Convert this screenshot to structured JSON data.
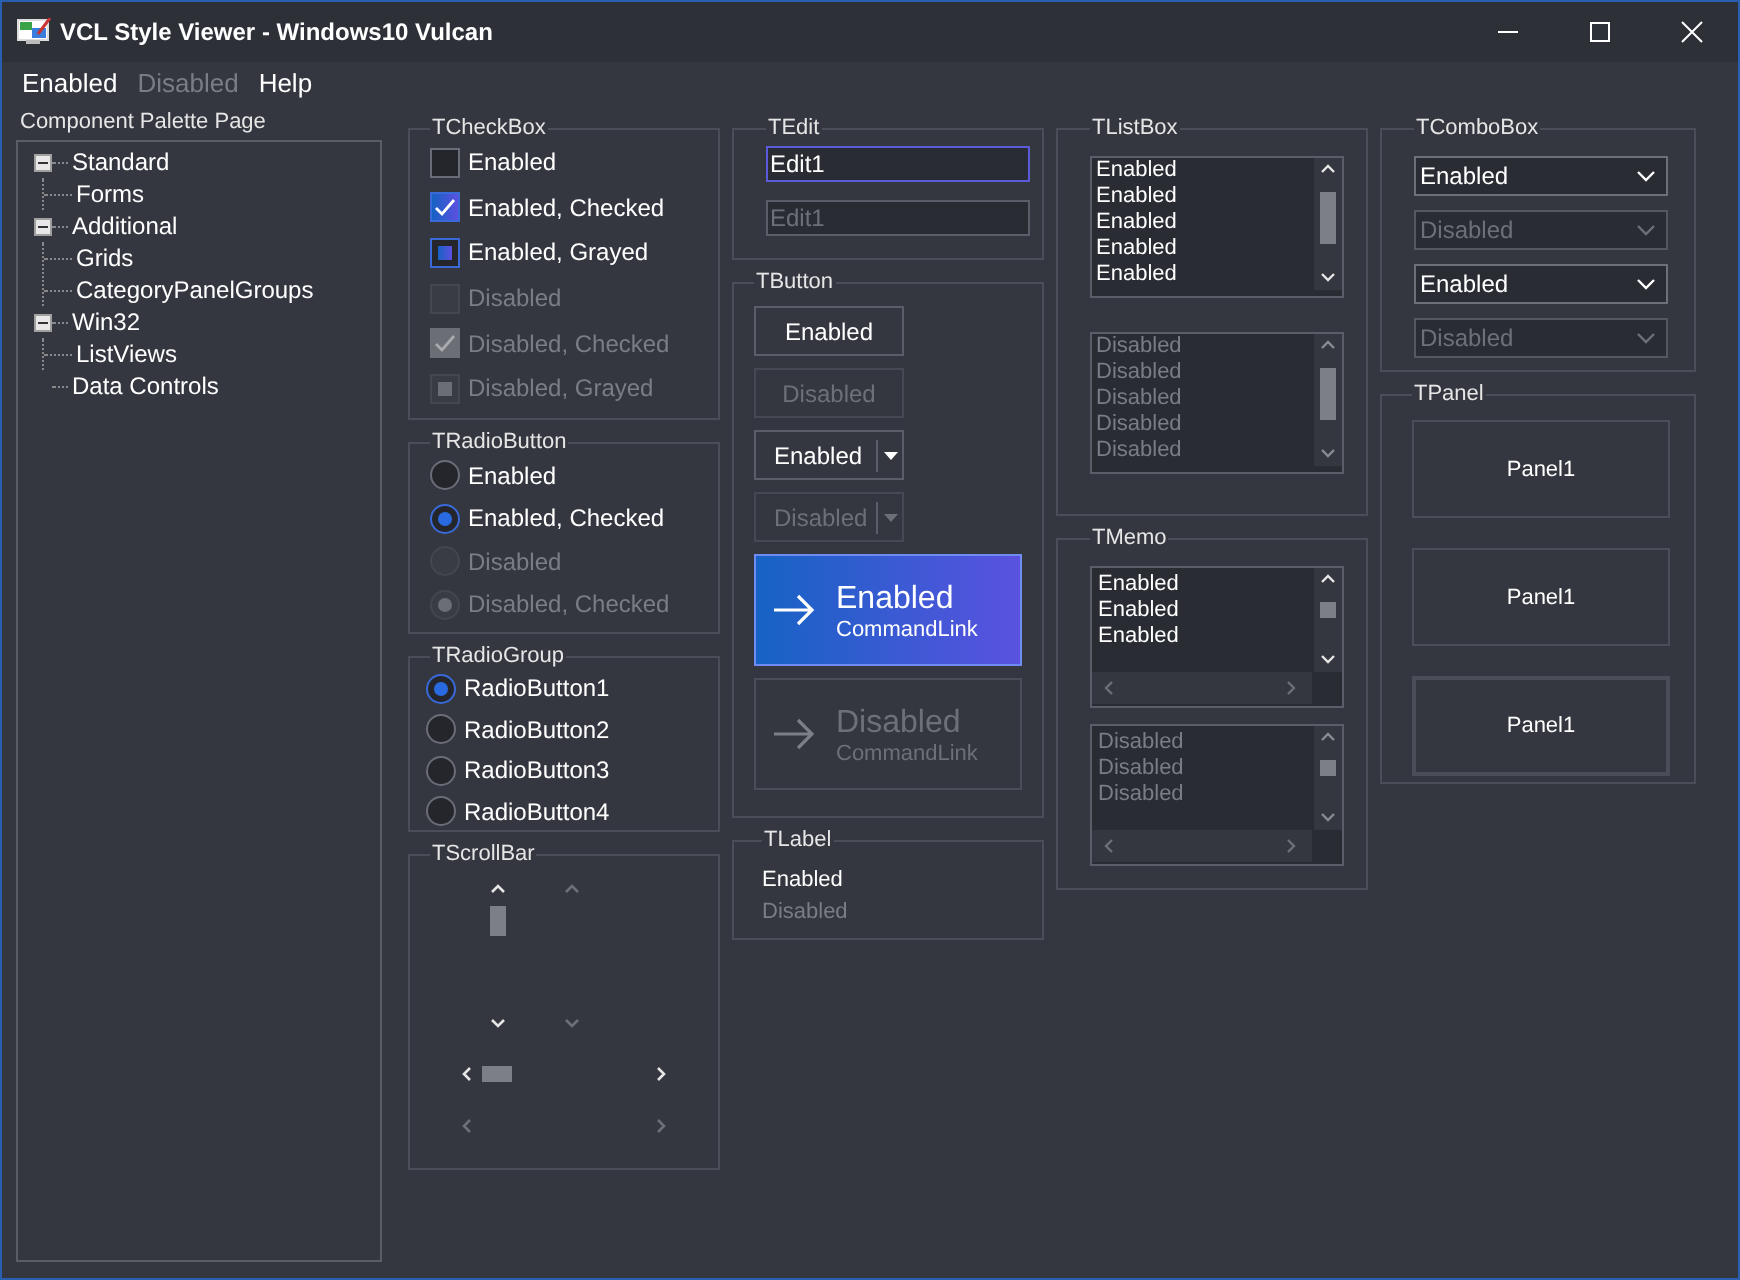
{
  "window": {
    "title": "VCL Style Viewer - Windows10 Vulcan"
  },
  "menu": [
    {
      "label": "Enabled",
      "disabled": false
    },
    {
      "label": "Disabled",
      "disabled": true
    },
    {
      "label": "Help",
      "disabled": false
    }
  ],
  "palette": {
    "label": "Component Palette Page",
    "tree": [
      {
        "label": "Standard",
        "expanded": true,
        "children": [
          {
            "label": "Forms"
          }
        ]
      },
      {
        "label": "Additional",
        "expanded": true,
        "children": [
          {
            "label": "Grids"
          },
          {
            "label": "CategoryPanelGroups"
          }
        ]
      },
      {
        "label": "Win32",
        "expanded": true,
        "children": [
          {
            "label": "ListViews"
          }
        ]
      },
      {
        "label": "Data Controls"
      }
    ]
  },
  "checkbox_group": {
    "title": "TCheckBox",
    "items": [
      {
        "label": "Enabled",
        "checked": false,
        "grayed": false,
        "disabled": false
      },
      {
        "label": "Enabled, Checked",
        "checked": true,
        "grayed": false,
        "disabled": false
      },
      {
        "label": "Enabled, Grayed",
        "checked": false,
        "grayed": true,
        "disabled": false
      },
      {
        "label": "Disabled",
        "checked": false,
        "grayed": false,
        "disabled": true
      },
      {
        "label": "Disabled, Checked",
        "checked": true,
        "grayed": false,
        "disabled": true
      },
      {
        "label": "Disabled, Grayed",
        "checked": false,
        "grayed": true,
        "disabled": true
      }
    ]
  },
  "radio_button_group": {
    "title": "TRadioButton",
    "items": [
      {
        "label": "Enabled",
        "selected": false,
        "disabled": false
      },
      {
        "label": "Enabled, Checked",
        "selected": true,
        "disabled": false
      },
      {
        "label": "Disabled",
        "selected": false,
        "disabled": true
      },
      {
        "label": "Disabled, Checked",
        "selected": true,
        "disabled": true
      }
    ]
  },
  "radio_group": {
    "title": "TRadioGroup",
    "items": [
      {
        "label": "RadioButton1",
        "selected": true
      },
      {
        "label": "RadioButton2",
        "selected": false
      },
      {
        "label": "RadioButton3",
        "selected": false
      },
      {
        "label": "RadioButton4",
        "selected": false
      }
    ]
  },
  "scrollbar_group": {
    "title": "TScrollBar"
  },
  "edit_group": {
    "title": "TEdit",
    "items": [
      {
        "value": "Edit1",
        "disabled": false
      },
      {
        "value": "Edit1",
        "disabled": true
      }
    ]
  },
  "button_group": {
    "title": "TButton",
    "items": [
      {
        "kind": "push",
        "label": "Enabled",
        "disabled": false
      },
      {
        "kind": "push",
        "label": "Disabled",
        "disabled": true
      },
      {
        "kind": "split",
        "label": "Enabled",
        "disabled": false
      },
      {
        "kind": "split",
        "label": "Disabled",
        "disabled": true
      },
      {
        "kind": "command_link",
        "label": "Enabled",
        "note": "CommandLink",
        "disabled": false
      },
      {
        "kind": "command_link",
        "label": "Disabled",
        "note": "CommandLink",
        "disabled": true
      }
    ]
  },
  "label_group": {
    "title": "TLabel",
    "items": [
      {
        "text": "Enabled",
        "disabled": false
      },
      {
        "text": "Disabled",
        "disabled": true
      }
    ]
  },
  "listbox_group": {
    "title": "TListBox",
    "items": [
      {
        "disabled": false,
        "lines": [
          "Enabled",
          "Enabled",
          "Enabled",
          "Enabled",
          "Enabled"
        ]
      },
      {
        "disabled": true,
        "lines": [
          "Disabled",
          "Disabled",
          "Disabled",
          "Disabled",
          "Disabled"
        ]
      }
    ]
  },
  "memo_group": {
    "title": "TMemo",
    "items": [
      {
        "disabled": false,
        "lines": [
          "Enabled",
          "Enabled",
          "Enabled"
        ]
      },
      {
        "disabled": true,
        "lines": [
          "Disabled",
          "Disabled",
          "Disabled"
        ]
      }
    ]
  },
  "combobox_group": {
    "title": "TComboBox",
    "items": [
      {
        "value": "Enabled",
        "disabled": false
      },
      {
        "value": "Disabled",
        "disabled": true
      },
      {
        "value": "Enabled",
        "disabled": false
      },
      {
        "value": "Disabled",
        "disabled": true
      }
    ]
  },
  "panel_group": {
    "title": "TPanel",
    "items": [
      {
        "label": "Panel1",
        "kind": "flat"
      },
      {
        "label": "Panel1",
        "kind": "flat"
      },
      {
        "label": "Panel1",
        "kind": "double"
      }
    ]
  }
}
